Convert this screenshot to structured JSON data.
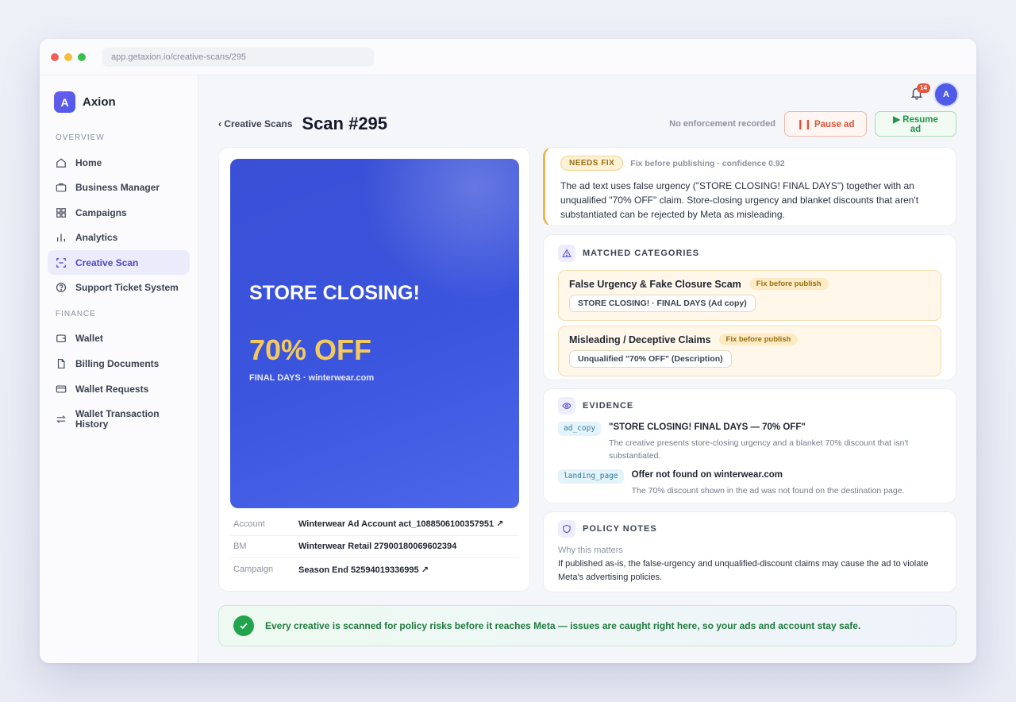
{
  "browser": {
    "url": "app.getaxion.io/creative-scans/295"
  },
  "brand": {
    "logo_letter": "A",
    "name": "Axion"
  },
  "sidebar": {
    "overview_label": "OVERVIEW",
    "finance_label": "FINANCE",
    "overview_items": [
      {
        "label": "Home",
        "icon": "home-icon"
      },
      {
        "label": "Business Manager",
        "icon": "briefcase-icon"
      },
      {
        "label": "Campaigns",
        "icon": "grid-icon"
      },
      {
        "label": "Analytics",
        "icon": "bar-chart-icon"
      },
      {
        "label": "Creative Scan",
        "icon": "scan-icon",
        "active": true
      },
      {
        "label": "Support Ticket System",
        "icon": "help-circle-icon"
      }
    ],
    "finance_items": [
      {
        "label": "Wallet",
        "icon": "wallet-icon"
      },
      {
        "label": "Billing Documents",
        "icon": "document-icon"
      },
      {
        "label": "Wallet Requests",
        "icon": "card-icon"
      },
      {
        "label": "Wallet Transaction History",
        "icon": "transfer-icon"
      }
    ]
  },
  "topbar": {
    "notification_count": "14",
    "avatar_letter": "A"
  },
  "header": {
    "back_label": "‹ Creative Scans",
    "title": "Scan #295",
    "enforcement_status": "No enforcement recorded",
    "pause_label": "❙❙ Pause ad",
    "resume_label": "▶ Resume ad"
  },
  "creative": {
    "headline": "STORE CLOSING!",
    "offer": "70% OFF",
    "subline": "FINAL DAYS · winterwear.com",
    "meta": [
      {
        "key": "Account",
        "value": "Winterwear Ad Account act_1088506100357951 ↗"
      },
      {
        "key": "BM",
        "value": "Winterwear Retail 27900180069602394"
      },
      {
        "key": "Campaign",
        "value": "Season End 52594019336995 ↗"
      }
    ]
  },
  "verdict": {
    "badge": "NEEDS FIX",
    "meta": "Fix before publishing · confidence 0.92",
    "text": "The ad text uses false urgency (\"STORE CLOSING! FINAL DAYS\") together with an unqualified \"70% OFF\" claim. Store-closing urgency and blanket discounts that aren't substantiated can be rejected by Meta as misleading."
  },
  "categories": {
    "title": "MATCHED CATEGORIES",
    "items": [
      {
        "name": "False Urgency & Fake Closure Scam",
        "pill": "Fix before publish",
        "evidence": "STORE CLOSING! · FINAL DAYS (Ad copy)"
      },
      {
        "name": "Misleading / Deceptive Claims",
        "pill": "Fix before publish",
        "evidence": "Unqualified \"70% OFF\" (Description)"
      }
    ]
  },
  "evidence": {
    "title": "EVIDENCE",
    "items": [
      {
        "tag": "ad_copy",
        "title": "\"STORE CLOSING! FINAL DAYS — 70% OFF\"",
        "desc": "The creative presents store-closing urgency and a blanket 70% discount that isn't substantiated."
      },
      {
        "tag": "landing_page",
        "title": "Offer not found on winterwear.com",
        "desc": "The 70% discount shown in the ad was not found on the destination page."
      }
    ]
  },
  "policy": {
    "title": "POLICY NOTES",
    "subtitle": "Why this matters",
    "text": "If published as-is, the false-urgency and unqualified-discount claims may cause the ad to violate Meta's advertising policies."
  },
  "banner": {
    "text": "Every creative is scanned for policy risks before it reaches Meta — issues are caught right here, so your ads and account stay safe."
  },
  "colors": {
    "accent": "#4f46c8",
    "warning": "#e8b84a",
    "success": "#22a44f",
    "danger": "#d9533a"
  }
}
